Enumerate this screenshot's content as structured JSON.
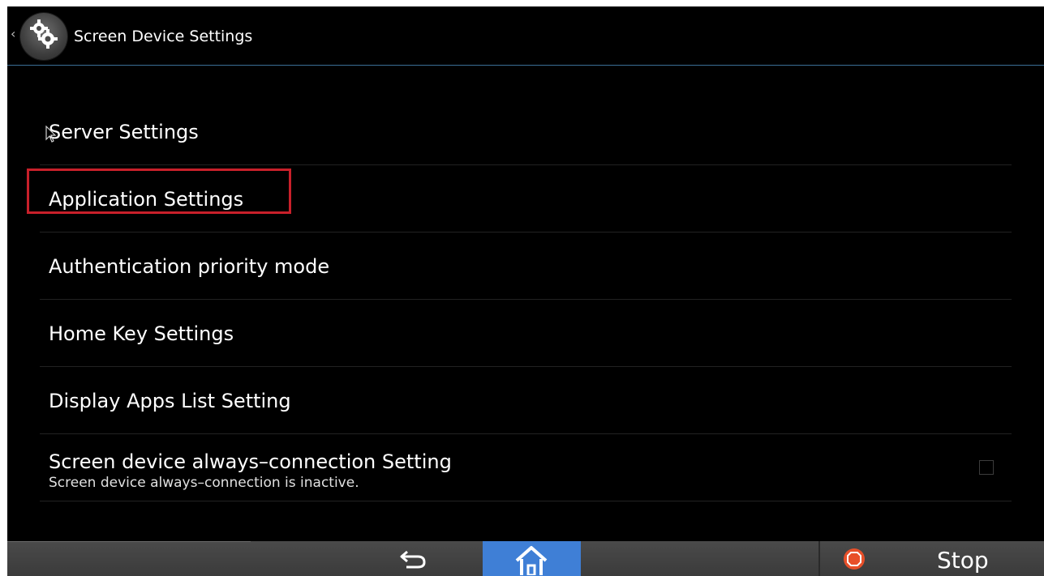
{
  "header": {
    "title": "Screen Device Settings",
    "back_chevron": "‹",
    "icon": "gear-icon"
  },
  "menu": {
    "items": [
      {
        "label": "Server Settings"
      },
      {
        "label": "Application Settings",
        "highlighted": true
      },
      {
        "label": "Authentication priority mode"
      },
      {
        "label": "Home Key Settings"
      },
      {
        "label": "Display Apps List Setting"
      },
      {
        "label": "Screen device always–connection Setting",
        "sublabel": "Screen device always–connection is inactive.",
        "checked": false
      }
    ]
  },
  "bottombar": {
    "back_icon": "back-arrow-icon",
    "home_icon": "home-icon",
    "stop_icon": "stop-icon",
    "stop_label": "Stop"
  },
  "colors": {
    "background": "#000000",
    "header_divider": "#3a6e96",
    "highlight_border": "#c8202a",
    "home_button": "#3f7fd6",
    "stop_icon": "#e8502a",
    "bottombar": "#444444"
  }
}
